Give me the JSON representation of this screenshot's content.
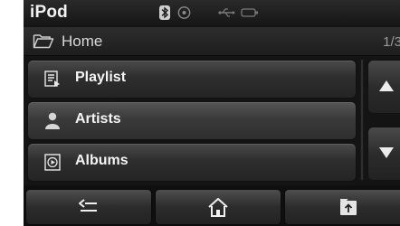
{
  "status_bar": {
    "app_title": "iPod",
    "icons": [
      "bluetooth-icon",
      "disc-icon",
      "usb-icon",
      "battery-icon"
    ]
  },
  "breadcrumb": {
    "icon": "folder-icon",
    "label": "Home",
    "page_indicator": "1/3"
  },
  "list": {
    "items": [
      {
        "icon": "playlist-icon",
        "label": "Playlist"
      },
      {
        "icon": "artist-icon",
        "label": "Artists"
      },
      {
        "icon": "album-icon",
        "label": "Albums"
      }
    ]
  },
  "scroll": {
    "up_icon": "arrow-up-icon",
    "down_icon": "arrow-down-icon"
  },
  "bottom_bar": {
    "buttons": [
      "back-icon",
      "home-icon",
      "parent-folder-icon"
    ]
  },
  "colors": {
    "background": "#141414",
    "text": "#f5f5f5",
    "button_gradient_top": "#4a4a4a",
    "button_gradient_bottom": "#242424"
  }
}
